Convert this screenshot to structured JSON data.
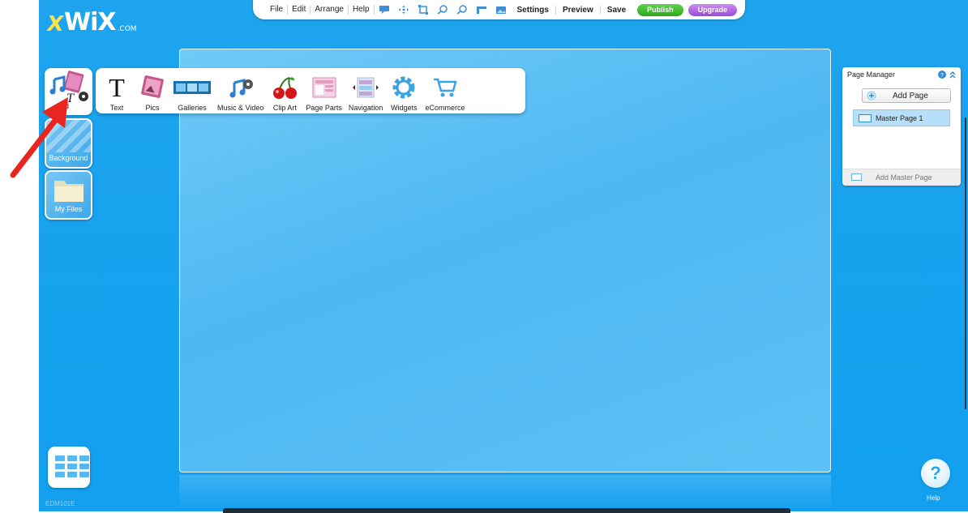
{
  "logo": {
    "text": "WiX",
    "suffix": ".COM"
  },
  "toolbar": {
    "menus": [
      "File",
      "Edit",
      "Arrange",
      "Help"
    ],
    "icons": [
      "comment-icon",
      "move-icon",
      "resize-icon",
      "zoom-in-icon",
      "zoom-out-icon",
      "ruler-icon",
      "image-icon"
    ],
    "settings": "Settings",
    "preview": "Preview",
    "save": "Save",
    "publish": "Publish",
    "upgrade": "Upgrade"
  },
  "rail": {
    "add": "Add",
    "background": "Background",
    "my_files": "My Files"
  },
  "add_panel": {
    "items": [
      "Text",
      "Pics",
      "Galleries",
      "Music & Video",
      "Clip Art",
      "Page Parts",
      "Navigation",
      "Widgets",
      "eCommerce"
    ]
  },
  "page_manager": {
    "title": "Page Manager",
    "add_page": "Add Page",
    "page_1": "Master Page 1",
    "add_master": "Add Master Page"
  },
  "footer": {
    "edm": "EDM101E",
    "help": "Help",
    "help_glyph": "?"
  },
  "colors": {
    "background": "#1ea4ee",
    "publish": "#2fa91b",
    "upgrade": "#9b4ad8",
    "arrow": "#e8251f"
  }
}
